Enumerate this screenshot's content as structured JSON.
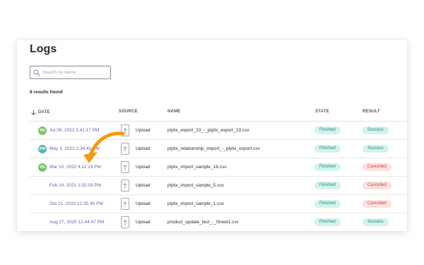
{
  "page": {
    "title": "Logs"
  },
  "search": {
    "placeholder": "Search by name",
    "value": ""
  },
  "results_count": "8 results found",
  "columns": {
    "date": "DATE",
    "source": "SOURCE",
    "name": "NAME",
    "state": "STATE",
    "result": "RESULT"
  },
  "colors": {
    "accent": "#6c5fa8",
    "arrow": "#f59a16",
    "success_bg": "#d3f2ec",
    "success_text": "#1b8a74",
    "cancel_bg": "#fde0df",
    "cancel_text": "#d04640",
    "avatar_pe": "#7dc46b",
    "avatar_rm": "#5bb3b0"
  },
  "rows": [
    {
      "avatar": "PE",
      "avatar_color": "#7dc46b",
      "date": "Jul 26, 2022 2:41:17 PM",
      "source": "Upload",
      "name": "plytix_export_23_-_plytix_export_23.csv",
      "state": "Finished",
      "result": "Success",
      "result_type": "green"
    },
    {
      "avatar": "RM",
      "avatar_color": "#5bb3b0",
      "date": "May 3, 2022 2:34:41 PM",
      "source": "Upload",
      "name": "plytix_relationship_import_-_plytix_export.csv",
      "state": "Finished",
      "result": "Success",
      "result_type": "green"
    },
    {
      "avatar": "PE",
      "avatar_color": "#7dc46b",
      "date": "Mar 10, 2022 4:11:19 PM",
      "source": "Upload",
      "name": "plytix_import_sample_18.csv",
      "state": "Finished",
      "result": "Cancelled",
      "result_type": "red"
    },
    {
      "avatar": "",
      "avatar_color": "",
      "date": "Feb 24, 2021 1:32:59 PM",
      "source": "Upload",
      "name": "plytix_import_sample_5.csv",
      "state": "Finished",
      "result": "Cancelled",
      "result_type": "red"
    },
    {
      "avatar": "",
      "avatar_color": "",
      "date": "Oct 21, 2020 12:35:45 PM",
      "source": "Upload",
      "name": "plytix_import_sample_1.csv",
      "state": "Finished",
      "result": "Cancelled",
      "result_type": "red"
    },
    {
      "avatar": "",
      "avatar_color": "",
      "date": "Aug 27, 2020 12:44:47 PM",
      "source": "Upload",
      "name": "product_update_test_-_Sheet1.csv",
      "state": "Finished",
      "result": "Success",
      "result_type": "green"
    }
  ]
}
